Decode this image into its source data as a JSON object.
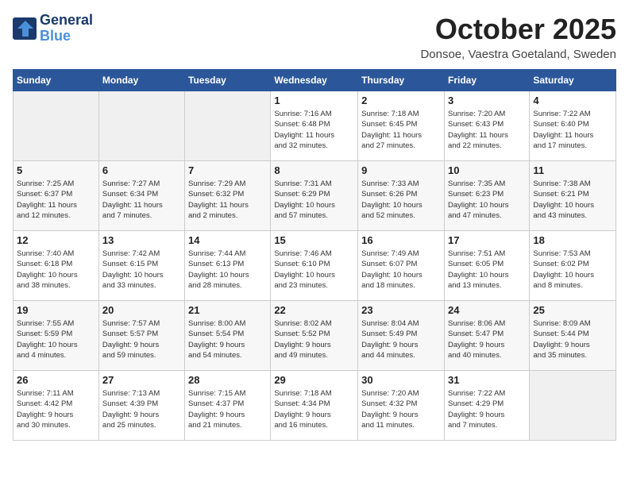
{
  "header": {
    "logo_line1": "General",
    "logo_line2": "Blue",
    "month": "October 2025",
    "location": "Donsoe, Vaestra Goetaland, Sweden"
  },
  "days_of_week": [
    "Sunday",
    "Monday",
    "Tuesday",
    "Wednesday",
    "Thursday",
    "Friday",
    "Saturday"
  ],
  "weeks": [
    [
      {
        "day": "",
        "info": ""
      },
      {
        "day": "",
        "info": ""
      },
      {
        "day": "",
        "info": ""
      },
      {
        "day": "1",
        "info": "Sunrise: 7:16 AM\nSunset: 6:48 PM\nDaylight: 11 hours\nand 32 minutes."
      },
      {
        "day": "2",
        "info": "Sunrise: 7:18 AM\nSunset: 6:45 PM\nDaylight: 11 hours\nand 27 minutes."
      },
      {
        "day": "3",
        "info": "Sunrise: 7:20 AM\nSunset: 6:43 PM\nDaylight: 11 hours\nand 22 minutes."
      },
      {
        "day": "4",
        "info": "Sunrise: 7:22 AM\nSunset: 6:40 PM\nDaylight: 11 hours\nand 17 minutes."
      }
    ],
    [
      {
        "day": "5",
        "info": "Sunrise: 7:25 AM\nSunset: 6:37 PM\nDaylight: 11 hours\nand 12 minutes."
      },
      {
        "day": "6",
        "info": "Sunrise: 7:27 AM\nSunset: 6:34 PM\nDaylight: 11 hours\nand 7 minutes."
      },
      {
        "day": "7",
        "info": "Sunrise: 7:29 AM\nSunset: 6:32 PM\nDaylight: 11 hours\nand 2 minutes."
      },
      {
        "day": "8",
        "info": "Sunrise: 7:31 AM\nSunset: 6:29 PM\nDaylight: 10 hours\nand 57 minutes."
      },
      {
        "day": "9",
        "info": "Sunrise: 7:33 AM\nSunset: 6:26 PM\nDaylight: 10 hours\nand 52 minutes."
      },
      {
        "day": "10",
        "info": "Sunrise: 7:35 AM\nSunset: 6:23 PM\nDaylight: 10 hours\nand 47 minutes."
      },
      {
        "day": "11",
        "info": "Sunrise: 7:38 AM\nSunset: 6:21 PM\nDaylight: 10 hours\nand 43 minutes."
      }
    ],
    [
      {
        "day": "12",
        "info": "Sunrise: 7:40 AM\nSunset: 6:18 PM\nDaylight: 10 hours\nand 38 minutes."
      },
      {
        "day": "13",
        "info": "Sunrise: 7:42 AM\nSunset: 6:15 PM\nDaylight: 10 hours\nand 33 minutes."
      },
      {
        "day": "14",
        "info": "Sunrise: 7:44 AM\nSunset: 6:13 PM\nDaylight: 10 hours\nand 28 minutes."
      },
      {
        "day": "15",
        "info": "Sunrise: 7:46 AM\nSunset: 6:10 PM\nDaylight: 10 hours\nand 23 minutes."
      },
      {
        "day": "16",
        "info": "Sunrise: 7:49 AM\nSunset: 6:07 PM\nDaylight: 10 hours\nand 18 minutes."
      },
      {
        "day": "17",
        "info": "Sunrise: 7:51 AM\nSunset: 6:05 PM\nDaylight: 10 hours\nand 13 minutes."
      },
      {
        "day": "18",
        "info": "Sunrise: 7:53 AM\nSunset: 6:02 PM\nDaylight: 10 hours\nand 8 minutes."
      }
    ],
    [
      {
        "day": "19",
        "info": "Sunrise: 7:55 AM\nSunset: 5:59 PM\nDaylight: 10 hours\nand 4 minutes."
      },
      {
        "day": "20",
        "info": "Sunrise: 7:57 AM\nSunset: 5:57 PM\nDaylight: 9 hours\nand 59 minutes."
      },
      {
        "day": "21",
        "info": "Sunrise: 8:00 AM\nSunset: 5:54 PM\nDaylight: 9 hours\nand 54 minutes."
      },
      {
        "day": "22",
        "info": "Sunrise: 8:02 AM\nSunset: 5:52 PM\nDaylight: 9 hours\nand 49 minutes."
      },
      {
        "day": "23",
        "info": "Sunrise: 8:04 AM\nSunset: 5:49 PM\nDaylight: 9 hours\nand 44 minutes."
      },
      {
        "day": "24",
        "info": "Sunrise: 8:06 AM\nSunset: 5:47 PM\nDaylight: 9 hours\nand 40 minutes."
      },
      {
        "day": "25",
        "info": "Sunrise: 8:09 AM\nSunset: 5:44 PM\nDaylight: 9 hours\nand 35 minutes."
      }
    ],
    [
      {
        "day": "26",
        "info": "Sunrise: 7:11 AM\nSunset: 4:42 PM\nDaylight: 9 hours\nand 30 minutes."
      },
      {
        "day": "27",
        "info": "Sunrise: 7:13 AM\nSunset: 4:39 PM\nDaylight: 9 hours\nand 25 minutes."
      },
      {
        "day": "28",
        "info": "Sunrise: 7:15 AM\nSunset: 4:37 PM\nDaylight: 9 hours\nand 21 minutes."
      },
      {
        "day": "29",
        "info": "Sunrise: 7:18 AM\nSunset: 4:34 PM\nDaylight: 9 hours\nand 16 minutes."
      },
      {
        "day": "30",
        "info": "Sunrise: 7:20 AM\nSunset: 4:32 PM\nDaylight: 9 hours\nand 11 minutes."
      },
      {
        "day": "31",
        "info": "Sunrise: 7:22 AM\nSunset: 4:29 PM\nDaylight: 9 hours\nand 7 minutes."
      },
      {
        "day": "",
        "info": ""
      }
    ]
  ]
}
